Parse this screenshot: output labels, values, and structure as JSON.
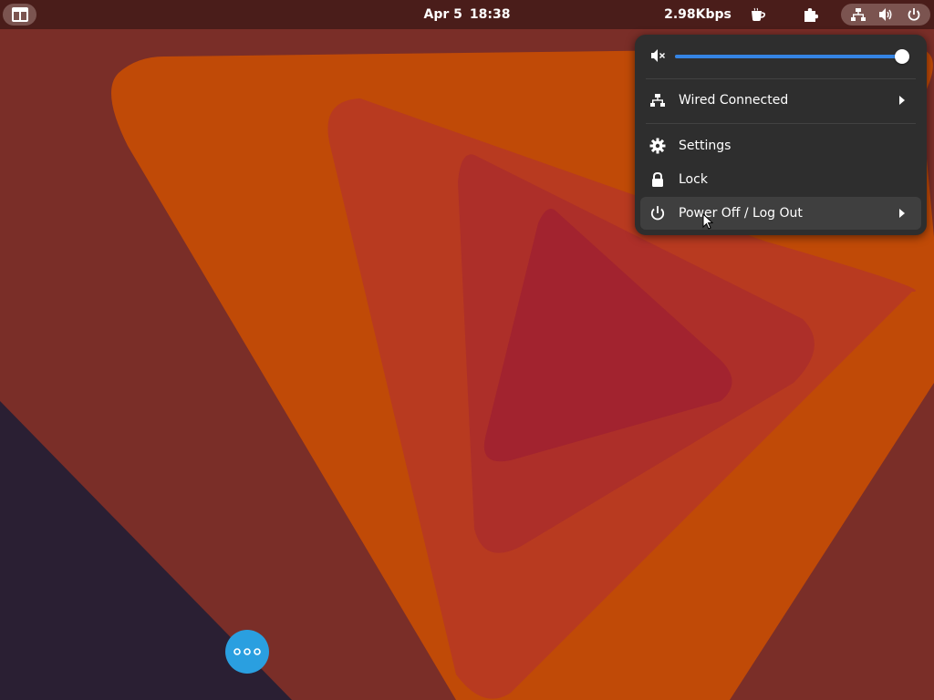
{
  "topbar": {
    "clock_date": "Apr 5",
    "clock_time": "18:38",
    "net_speed": "2.98Kbps"
  },
  "quick_menu": {
    "volume_level": 0.98,
    "items": [
      {
        "label": "Wired Connected",
        "icon": "network-wired-icon",
        "submenu": true
      },
      {
        "label": "Settings",
        "icon": "gear-icon",
        "submenu": false
      },
      {
        "label": "Lock",
        "icon": "lock-icon",
        "submenu": false
      },
      {
        "label": "Power Off / Log Out",
        "icon": "power-icon",
        "submenu": true
      }
    ]
  },
  "colors": {
    "topbar": "#4a1d1a",
    "menu_bg": "#2e2e2e",
    "accent": "#3584e4",
    "dock_button": "#2a9fe0"
  }
}
